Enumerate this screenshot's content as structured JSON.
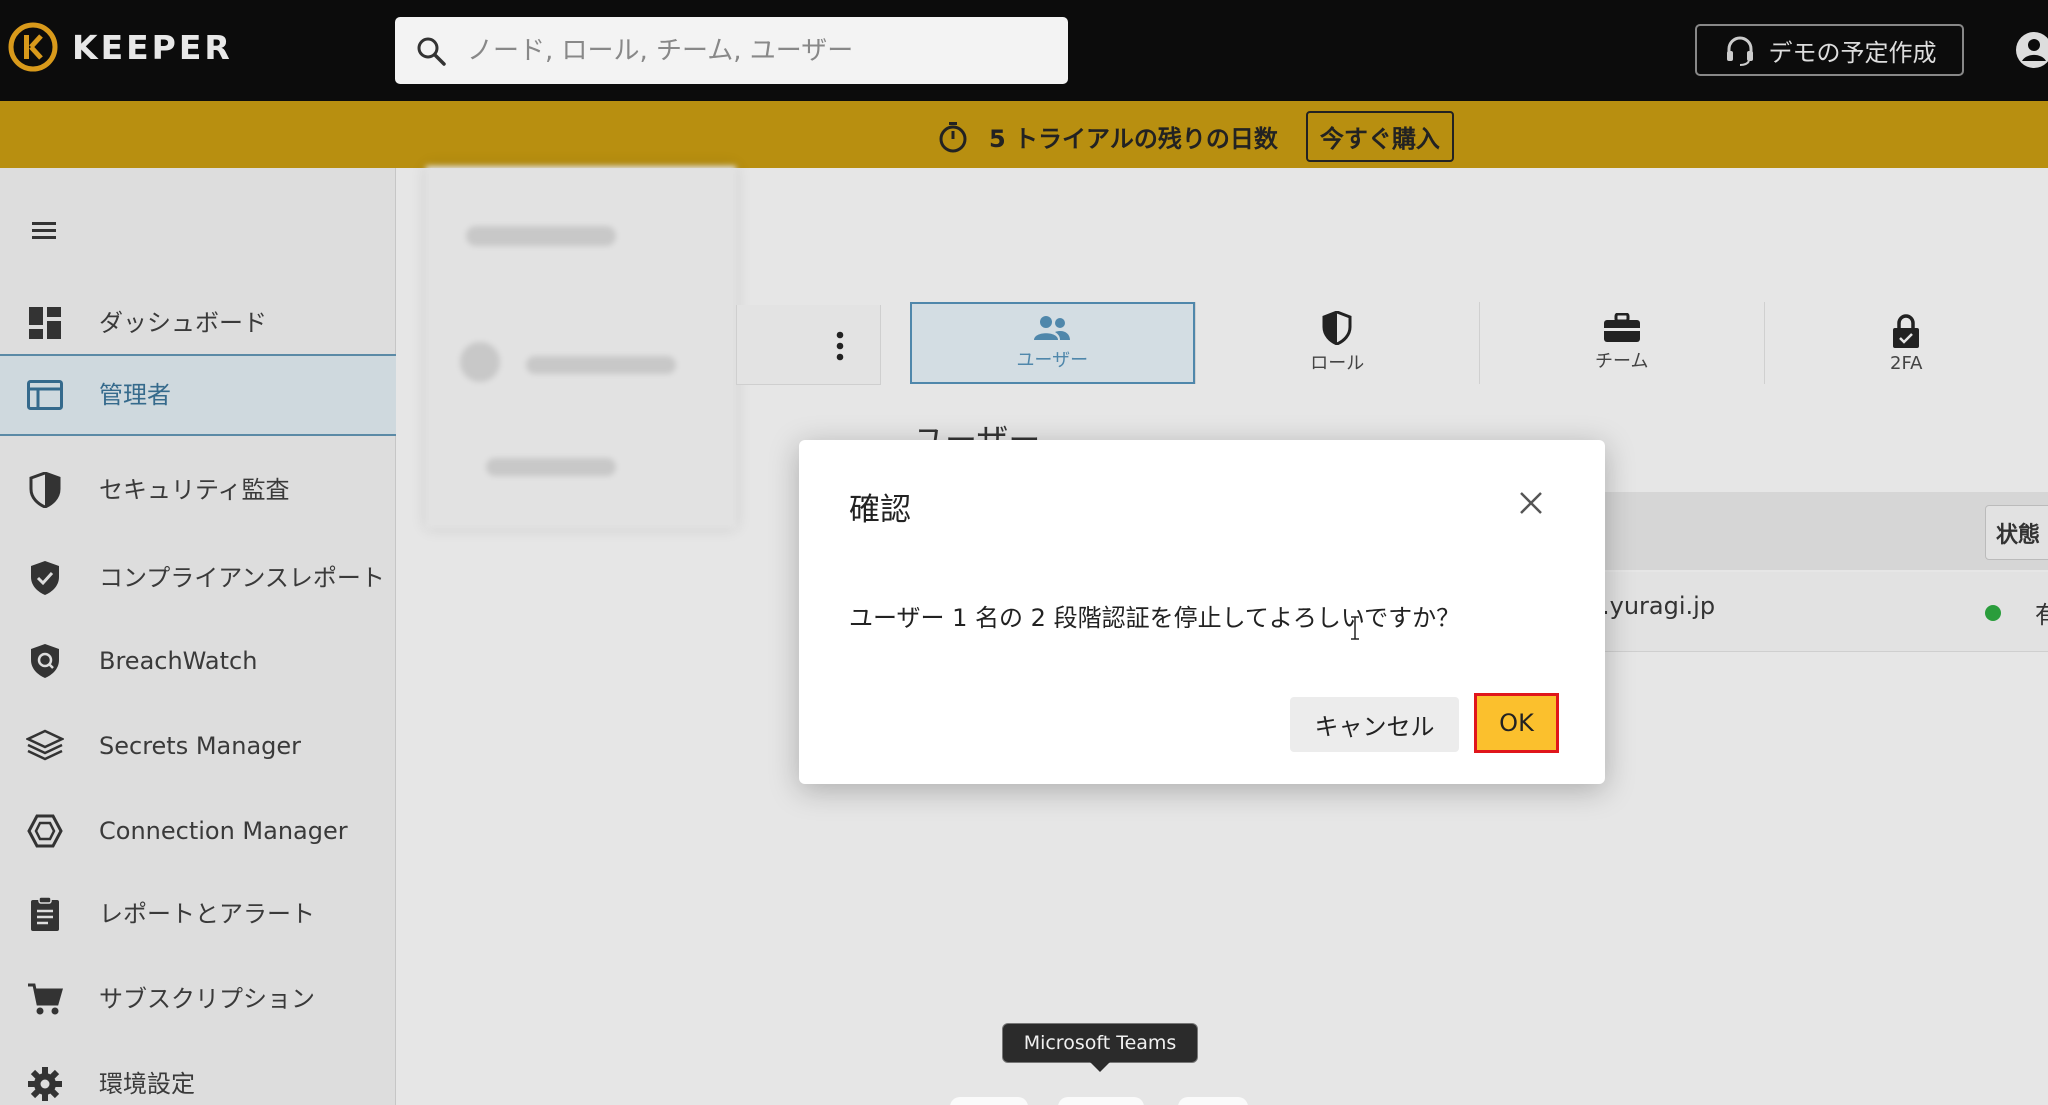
{
  "header": {
    "brand": "KEEPER",
    "search_placeholder": "ノード, ロール, チーム, ユーザー",
    "demo_button": "デモの予定作成"
  },
  "banner": {
    "text": "5 トライアルの残りの日数",
    "buy_button": "今すぐ購入"
  },
  "sidebar": {
    "items": [
      {
        "label": "ダッシュボード",
        "icon": "dashboard-icon"
      },
      {
        "label": "管理者",
        "icon": "admin-icon",
        "active": true
      },
      {
        "label": "セキュリティ監査",
        "icon": "shield-icon"
      },
      {
        "label": "コンプライアンスレポート",
        "icon": "shield-check-icon"
      },
      {
        "label": "BreachWatch",
        "icon": "breachwatch-icon"
      },
      {
        "label": "Secrets Manager",
        "icon": "layers-icon"
      },
      {
        "label": "Connection Manager",
        "icon": "hexagon-icon"
      },
      {
        "label": "レポートとアラート",
        "icon": "clipboard-icon"
      },
      {
        "label": "サブスクリプション",
        "icon": "cart-icon"
      },
      {
        "label": "環境設定",
        "icon": "gear-icon"
      }
    ]
  },
  "tabs": [
    {
      "label": "ユーザー",
      "icon": "users-icon",
      "active": true
    },
    {
      "label": "ロール",
      "icon": "shield-icon"
    },
    {
      "label": "チーム",
      "icon": "briefcase-icon"
    },
    {
      "label": "2FA",
      "icon": "lock-icon"
    }
  ],
  "main": {
    "section_heading": "ユーザー",
    "column_state": "状態",
    "row_email": ".yuragi.jp",
    "row_status": "有"
  },
  "modal": {
    "title": "確認",
    "message": "ユーザー 1 名の 2 段階認証を停止してよろしいですか？",
    "cancel": "キャンセル",
    "ok": "OK"
  },
  "tooltip": "Microsoft Teams",
  "colors": {
    "banner": "#b88f10",
    "accent": "#4f87ab",
    "ok": "#fbc02d",
    "highlight": "#e0161b"
  }
}
